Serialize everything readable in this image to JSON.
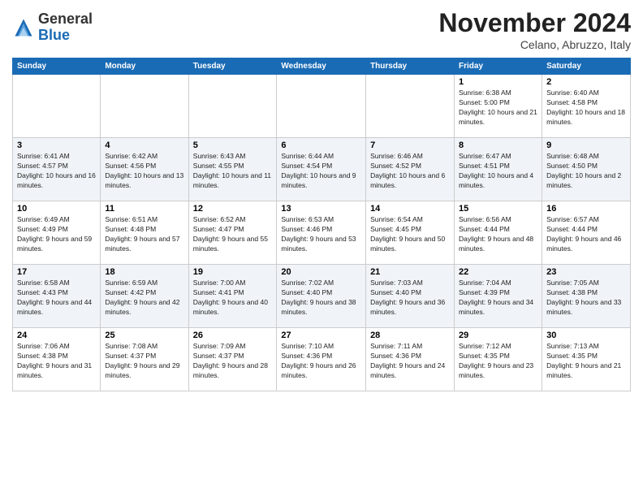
{
  "logo": {
    "general": "General",
    "blue": "Blue"
  },
  "title": "November 2024",
  "location": "Celano, Abruzzo, Italy",
  "days_header": [
    "Sunday",
    "Monday",
    "Tuesday",
    "Wednesday",
    "Thursday",
    "Friday",
    "Saturday"
  ],
  "weeks": [
    [
      {
        "num": "",
        "info": ""
      },
      {
        "num": "",
        "info": ""
      },
      {
        "num": "",
        "info": ""
      },
      {
        "num": "",
        "info": ""
      },
      {
        "num": "",
        "info": ""
      },
      {
        "num": "1",
        "info": "Sunrise: 6:38 AM\nSunset: 5:00 PM\nDaylight: 10 hours and 21 minutes."
      },
      {
        "num": "2",
        "info": "Sunrise: 6:40 AM\nSunset: 4:58 PM\nDaylight: 10 hours and 18 minutes."
      }
    ],
    [
      {
        "num": "3",
        "info": "Sunrise: 6:41 AM\nSunset: 4:57 PM\nDaylight: 10 hours and 16 minutes."
      },
      {
        "num": "4",
        "info": "Sunrise: 6:42 AM\nSunset: 4:56 PM\nDaylight: 10 hours and 13 minutes."
      },
      {
        "num": "5",
        "info": "Sunrise: 6:43 AM\nSunset: 4:55 PM\nDaylight: 10 hours and 11 minutes."
      },
      {
        "num": "6",
        "info": "Sunrise: 6:44 AM\nSunset: 4:54 PM\nDaylight: 10 hours and 9 minutes."
      },
      {
        "num": "7",
        "info": "Sunrise: 6:46 AM\nSunset: 4:52 PM\nDaylight: 10 hours and 6 minutes."
      },
      {
        "num": "8",
        "info": "Sunrise: 6:47 AM\nSunset: 4:51 PM\nDaylight: 10 hours and 4 minutes."
      },
      {
        "num": "9",
        "info": "Sunrise: 6:48 AM\nSunset: 4:50 PM\nDaylight: 10 hours and 2 minutes."
      }
    ],
    [
      {
        "num": "10",
        "info": "Sunrise: 6:49 AM\nSunset: 4:49 PM\nDaylight: 9 hours and 59 minutes."
      },
      {
        "num": "11",
        "info": "Sunrise: 6:51 AM\nSunset: 4:48 PM\nDaylight: 9 hours and 57 minutes."
      },
      {
        "num": "12",
        "info": "Sunrise: 6:52 AM\nSunset: 4:47 PM\nDaylight: 9 hours and 55 minutes."
      },
      {
        "num": "13",
        "info": "Sunrise: 6:53 AM\nSunset: 4:46 PM\nDaylight: 9 hours and 53 minutes."
      },
      {
        "num": "14",
        "info": "Sunrise: 6:54 AM\nSunset: 4:45 PM\nDaylight: 9 hours and 50 minutes."
      },
      {
        "num": "15",
        "info": "Sunrise: 6:56 AM\nSunset: 4:44 PM\nDaylight: 9 hours and 48 minutes."
      },
      {
        "num": "16",
        "info": "Sunrise: 6:57 AM\nSunset: 4:44 PM\nDaylight: 9 hours and 46 minutes."
      }
    ],
    [
      {
        "num": "17",
        "info": "Sunrise: 6:58 AM\nSunset: 4:43 PM\nDaylight: 9 hours and 44 minutes."
      },
      {
        "num": "18",
        "info": "Sunrise: 6:59 AM\nSunset: 4:42 PM\nDaylight: 9 hours and 42 minutes."
      },
      {
        "num": "19",
        "info": "Sunrise: 7:00 AM\nSunset: 4:41 PM\nDaylight: 9 hours and 40 minutes."
      },
      {
        "num": "20",
        "info": "Sunrise: 7:02 AM\nSunset: 4:40 PM\nDaylight: 9 hours and 38 minutes."
      },
      {
        "num": "21",
        "info": "Sunrise: 7:03 AM\nSunset: 4:40 PM\nDaylight: 9 hours and 36 minutes."
      },
      {
        "num": "22",
        "info": "Sunrise: 7:04 AM\nSunset: 4:39 PM\nDaylight: 9 hours and 34 minutes."
      },
      {
        "num": "23",
        "info": "Sunrise: 7:05 AM\nSunset: 4:38 PM\nDaylight: 9 hours and 33 minutes."
      }
    ],
    [
      {
        "num": "24",
        "info": "Sunrise: 7:06 AM\nSunset: 4:38 PM\nDaylight: 9 hours and 31 minutes."
      },
      {
        "num": "25",
        "info": "Sunrise: 7:08 AM\nSunset: 4:37 PM\nDaylight: 9 hours and 29 minutes."
      },
      {
        "num": "26",
        "info": "Sunrise: 7:09 AM\nSunset: 4:37 PM\nDaylight: 9 hours and 28 minutes."
      },
      {
        "num": "27",
        "info": "Sunrise: 7:10 AM\nSunset: 4:36 PM\nDaylight: 9 hours and 26 minutes."
      },
      {
        "num": "28",
        "info": "Sunrise: 7:11 AM\nSunset: 4:36 PM\nDaylight: 9 hours and 24 minutes."
      },
      {
        "num": "29",
        "info": "Sunrise: 7:12 AM\nSunset: 4:35 PM\nDaylight: 9 hours and 23 minutes."
      },
      {
        "num": "30",
        "info": "Sunrise: 7:13 AM\nSunset: 4:35 PM\nDaylight: 9 hours and 21 minutes."
      }
    ]
  ]
}
